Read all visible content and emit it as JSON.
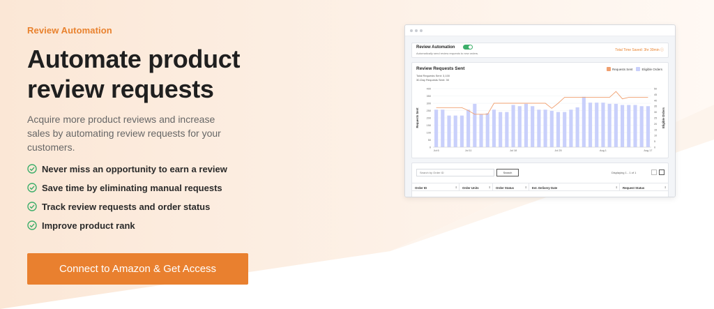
{
  "hero": {
    "eyebrow": "Review Automation",
    "headline": "Automate product review requests",
    "subtext": "Acquire more product reviews and increase sales by automating review requests for your customers.",
    "bullets": [
      "Never miss an opportunity to earn a review",
      "Save time by eliminating manual requests",
      "Track review requests and order status",
      "Improve product rank"
    ],
    "cta_label": "Connect to Amazon & Get Access"
  },
  "mockup": {
    "automation": {
      "title": "Review Automation",
      "subtitle": "Automatically send review requests to new orders.",
      "time_saved": "Total Time Saved: 3hr 30min ⓘ",
      "toggle_on": true
    },
    "chart_card": {
      "title": "Review Requests Sent",
      "total_sent": "Total Requests Sent: 3,100",
      "thirty_day": "30-Day Requests Sent: 30",
      "legend": [
        "Requests Sent",
        "Eligible Orders"
      ]
    },
    "table": {
      "search_placeholder": "Search by Order ID",
      "search_button": "Search",
      "displaying": "Displaying 1 - 1 of 1",
      "columns": [
        "Order ID",
        "Order Units",
        "Order Status",
        "Est. Delivery Date",
        "Request Status"
      ]
    }
  },
  "colors": {
    "accent": "#e9802f",
    "check": "#3cae6a",
    "bar": "#c9d0fb",
    "line": "#f0a070"
  },
  "chart_data": {
    "type": "bar",
    "categories": [
      "Jul 6",
      "",
      "",
      "",
      "",
      "Jul 11",
      "",
      "",
      "",
      "",
      "",
      "",
      "Jul 18",
      "",
      "",
      "",
      "",
      "",
      "",
      "Jul 25",
      "",
      "",
      "",
      "",
      "",
      "",
      "Aug 1",
      "",
      "",
      "",
      "",
      "",
      "",
      "Aug 17"
    ],
    "series": [
      {
        "name": "Eligible Orders",
        "axis": "right",
        "values": [
          32,
          32,
          27,
          27,
          27,
          32,
          37,
          28,
          29,
          32,
          30,
          30,
          36,
          35,
          37,
          35,
          32,
          32,
          31,
          30,
          30,
          32,
          34,
          43,
          38,
          38,
          38,
          37,
          37,
          36,
          36,
          36,
          35,
          35
        ]
      },
      {
        "name": "Requests Sent",
        "axis": "left",
        "values": [
          270,
          270,
          270,
          270,
          270,
          250,
          225,
          225,
          225,
          300,
          300,
          300,
          300,
          300,
          300,
          300,
          300,
          300,
          265,
          300,
          340,
          340,
          340,
          340,
          340,
          340,
          340,
          340,
          380,
          330,
          340,
          340,
          340,
          340
        ]
      }
    ],
    "ylabel": "Requests Sent",
    "y2label": "Eligible Orders",
    "ylim": [
      0,
      400
    ],
    "y2lim": [
      0,
      50
    ],
    "yticks": [
      "0",
      "50",
      "100",
      "150",
      "200",
      "250",
      "300",
      "350",
      "400"
    ],
    "y2ticks": [
      "0",
      "5",
      "10",
      "15",
      "20",
      "25",
      "30",
      "35",
      "40",
      "45",
      "50"
    ],
    "xtick_labels": [
      "Jul 6",
      "Jul 11",
      "Jul 18",
      "Jul 25",
      "Aug 1",
      "Aug 17"
    ]
  }
}
